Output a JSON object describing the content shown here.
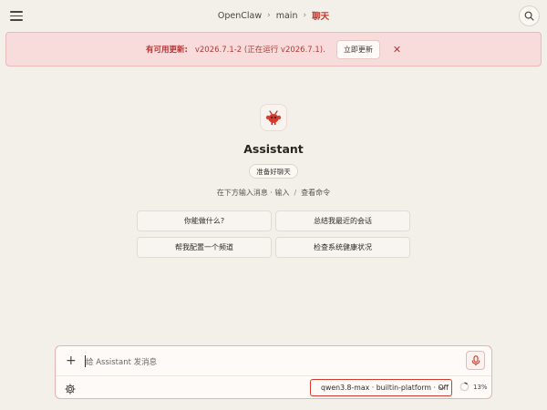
{
  "header": {
    "breadcrumb": [
      "OpenClaw",
      "main",
      "聊天"
    ]
  },
  "banner": {
    "label": "有可用更新:",
    "version_text": "v2026.7.1-2 (正在运行 v2026.7.1).",
    "update_button": "立即更新",
    "close_symbol": "✕",
    "colors": {
      "background": "#f8dcdc",
      "text": "#b23a3a"
    }
  },
  "assistant": {
    "name": "Assistant",
    "status_badge": "准备好聊天",
    "hint_left": "在下方输入消息 · 输入",
    "hint_sep": "/",
    "hint_right": "查看命令"
  },
  "suggestions": [
    "你能做什么?",
    "总结我最近的会话",
    "帮我配置一个频道",
    "检查系统健康状况"
  ],
  "composer": {
    "placeholder": "给 Assistant 发消息",
    "model_select": "qwen3.8-max · builtin-platform · Off",
    "context_usage": "13%",
    "context_usage_value": 0.13,
    "accent_color": "#d63a2f"
  }
}
